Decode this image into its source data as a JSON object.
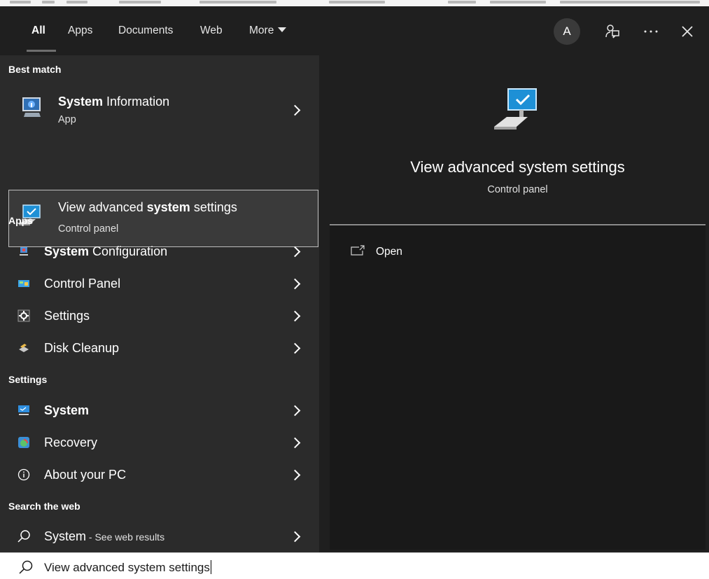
{
  "tabs": [
    {
      "label": "All",
      "active": true
    },
    {
      "label": "Apps"
    },
    {
      "label": "Documents"
    },
    {
      "label": "Web"
    },
    {
      "label": "More"
    }
  ],
  "user": {
    "avatar_initial": "A"
  },
  "top_icons": [
    "feedback-icon",
    "more-options-icon",
    "close-icon"
  ],
  "sections": {
    "best_match": "Best match",
    "apps": "Apps",
    "settings": "Settings",
    "web": "Search the web"
  },
  "best_match": [
    {
      "title_bold": "System",
      "title_rest": " Information",
      "subtitle": "App",
      "icon": "system-information-icon",
      "has_chevron": true
    },
    {
      "title_pre": "View advanced ",
      "title_bold": "system",
      "title_rest": " settings",
      "subtitle": "Control panel",
      "icon": "advanced-system-settings-icon",
      "selected": true
    }
  ],
  "apps": [
    {
      "bold": "System",
      "rest": " Configuration",
      "icon": "system-configuration-icon"
    },
    {
      "bold": "",
      "rest": "Control Panel",
      "icon": "control-panel-icon"
    },
    {
      "bold": "",
      "rest": "Settings",
      "icon": "settings-gear-icon"
    },
    {
      "bold": "",
      "rest": "Disk Cleanup",
      "icon": "disk-cleanup-icon"
    }
  ],
  "settings": [
    {
      "bold": "System",
      "rest": "",
      "icon": "system-display-icon"
    },
    {
      "bold": "",
      "rest": "Recovery",
      "icon": "recovery-icon"
    },
    {
      "bold": "",
      "rest": "About your PC",
      "icon": "info-icon"
    }
  ],
  "web": {
    "query": "System",
    "suffix": " - See web results",
    "icon": "search-icon"
  },
  "preview": {
    "title": "View advanced system settings",
    "subtitle": "Control panel",
    "actions": [
      {
        "label": "Open",
        "icon": "open-external-icon"
      }
    ]
  },
  "search": {
    "value": "View advanced system settings",
    "icon": "search-icon"
  },
  "colors": {
    "panel_bg": "#1f1f1f",
    "list_bg": "#2b2b2b",
    "selected_bg": "#3a3a3a",
    "accent_blue": "#1e90d6"
  }
}
